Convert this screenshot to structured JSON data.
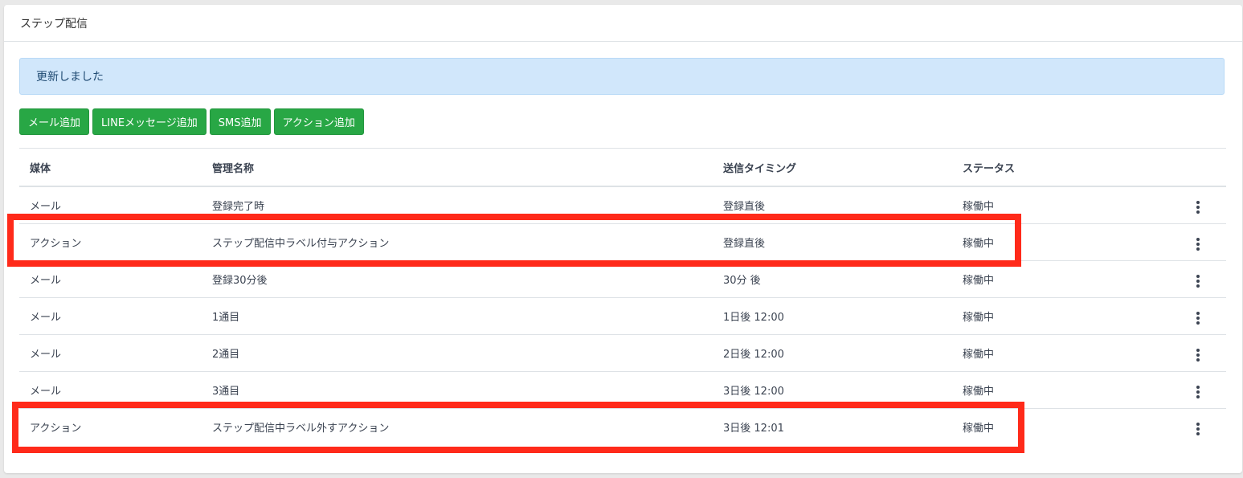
{
  "card": {
    "title": "ステップ配信"
  },
  "alert": {
    "message": "更新しました"
  },
  "buttons": [
    {
      "label": "メール追加"
    },
    {
      "label": "LINEメッセージ追加"
    },
    {
      "label": "SMS追加"
    },
    {
      "label": "アクション追加"
    }
  ],
  "table": {
    "headers": {
      "media": "媒体",
      "name": "管理名称",
      "timing": "送信タイミング",
      "status": "ステータス"
    },
    "rows": [
      {
        "media": "メール",
        "name": "登録完了時",
        "timing": "登録直後",
        "status": "稼働中"
      },
      {
        "media": "アクション",
        "name": "ステップ配信中ラベル付与アクション",
        "timing": "登録直後",
        "status": "稼働中"
      },
      {
        "media": "メール",
        "name": "登録30分後",
        "timing": "30分 後",
        "status": "稼働中"
      },
      {
        "media": "メール",
        "name": "1通目",
        "timing": "1日後 12:00",
        "status": "稼働中"
      },
      {
        "media": "メール",
        "name": "2通目",
        "timing": "2日後 12:00",
        "status": "稼働中"
      },
      {
        "media": "メール",
        "name": "3通目",
        "timing": "3日後 12:00",
        "status": "稼働中"
      },
      {
        "media": "アクション",
        "name": "ステップ配信中ラベル外すアクション",
        "timing": "3日後 12:01",
        "status": "稼働中"
      }
    ]
  },
  "colors": {
    "button_green": "#28a745",
    "alert_bg": "#d1e7fb",
    "highlight_red": "#ff2a1a"
  },
  "icons": {
    "row_menu": "kebab-menu-icon"
  }
}
